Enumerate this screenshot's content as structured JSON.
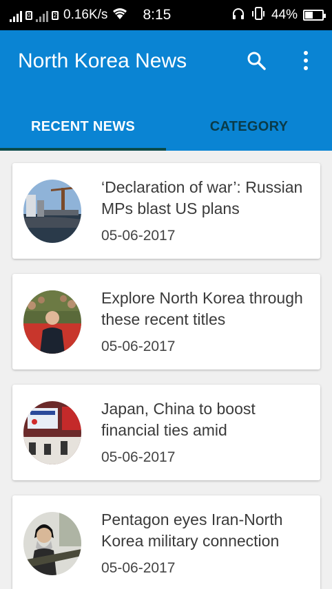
{
  "status_bar": {
    "sim1": "0",
    "sim2": "2",
    "network_speed": "0.16K/s",
    "time": "8:15",
    "battery_percent": "44%",
    "battery_level": 0.44
  },
  "app_bar": {
    "title": "North Korea News",
    "search_icon": "search-icon",
    "more_icon": "more-vert-icon",
    "color": "#0a84d3"
  },
  "tabs": [
    {
      "label": "RECENT NEWS",
      "selected": true
    },
    {
      "label": "CATEGORY",
      "selected": false
    }
  ],
  "news": [
    {
      "title": "‘Declaration of war’: Russian MPs blast US plans",
      "date": "05-06-2017",
      "image": "harbor-cranes-photo"
    },
    {
      "title": "Explore North Korea through these recent titles",
      "date": "05-06-2017",
      "image": "leader-applause-photo"
    },
    {
      "title": "Japan, China to boost financial ties amid",
      "date": "05-06-2017",
      "image": "conference-room-photo"
    },
    {
      "title": "Pentagon eyes Iran-North Korea military connection",
      "date": "05-06-2017",
      "image": "cleric-missile-photo"
    }
  ]
}
